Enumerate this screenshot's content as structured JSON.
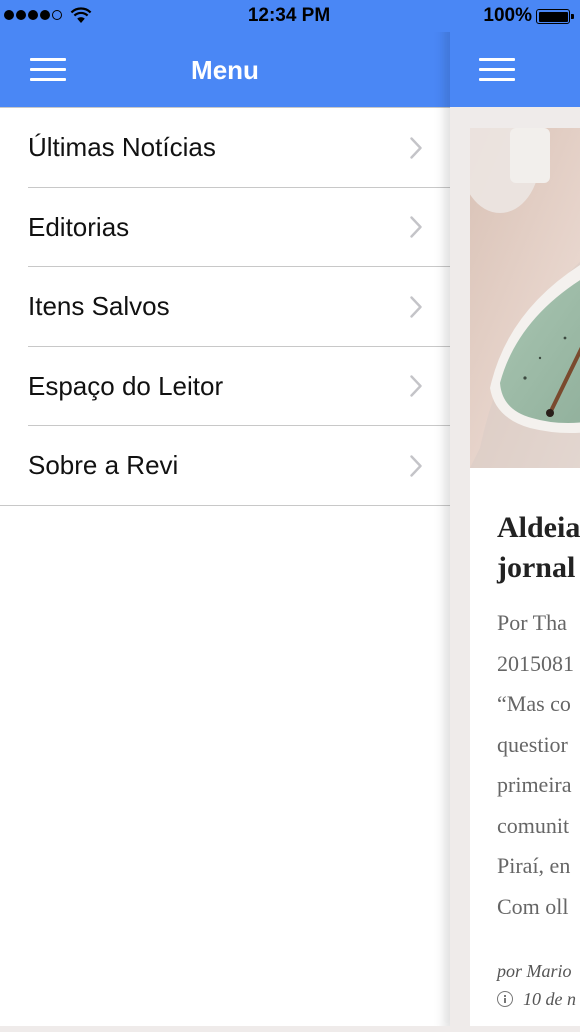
{
  "status_bar": {
    "time": "12:34 PM",
    "battery_percent": "100%",
    "signal_bars_filled": 4,
    "signal_bars_total": 5
  },
  "menu": {
    "title": "Menu",
    "items": [
      {
        "label": "Últimas Notícias"
      },
      {
        "label": "Editorias"
      },
      {
        "label": "Itens Salvos"
      },
      {
        "label": "Espaço do Leitor"
      },
      {
        "label": "Sobre a Revi"
      }
    ]
  },
  "article_card": {
    "title_lines": [
      "Aldeia",
      "jornal"
    ],
    "excerpt_lines": [
      "Por Tha",
      "2015081",
      "“Mas co",
      "questior",
      "primeira",
      "comunit",
      "Piraí, en",
      "Com oll"
    ],
    "author": "por Mario",
    "date": "10 de n"
  },
  "colors": {
    "header_blue": "#4a87f5",
    "divider": "#c8c8c8",
    "content_bg": "#efebea"
  }
}
